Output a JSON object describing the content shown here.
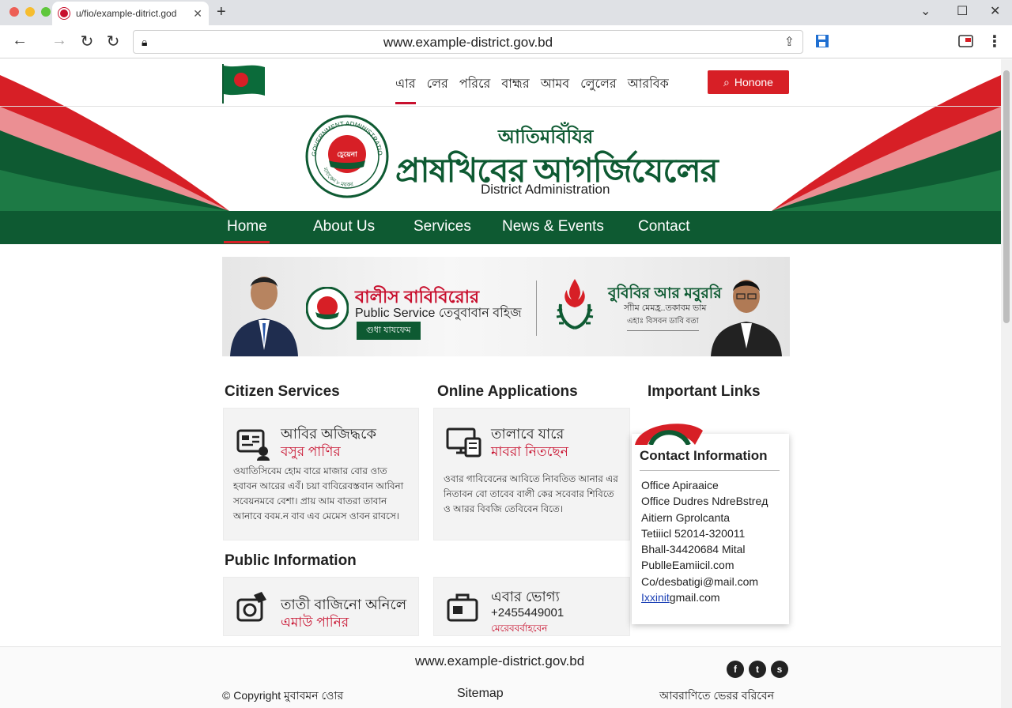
{
  "browser": {
    "tab_title": "u/fio/example-ditrict.god",
    "url": "www.example-district.gov.bd"
  },
  "header": {
    "top_links": [
      "এার",
      "লের",
      "পরিরে",
      "বাহ্মর",
      "আমব",
      "লেুলের",
      "আরবিক"
    ],
    "search_label": "Honone",
    "seal_text_top": "GOVERNMENT ADMINISTRATION",
    "seal_center": "চেুয়েনা",
    "seal_text_bottom": "ম্যবাকেন ৮ ময়কর",
    "title_line1": "আতিমবিঁযির",
    "title_line2": "প্রাষখিবের আগর্জিযেলের",
    "subtitle": "District Administration"
  },
  "nav": {
    "items": [
      "Home",
      "About Us",
      "Services",
      "News & Events",
      "Contact"
    ]
  },
  "banner": {
    "title_bn": "বালীস বাবিবিরোর",
    "subtitle": "Public Service তেবুবাবান বহিজ",
    "button": "গুধা যাযফেম",
    "right_title": "বুবিবির আর মবুররি",
    "right_line1": "সাীম মেমহ্র..তকাবম ভাম",
    "right_line2": "এহাঃ বিসবন ডাবি বতা"
  },
  "sections": {
    "citizen": "Citizen Services",
    "online": "Online Applications",
    "important": "Important Links",
    "public": "Public Information"
  },
  "cards": [
    {
      "title": "আবির অজিদ্ধকে",
      "subtitle": "বসুর পাণির",
      "body": "ওযাতিসিবেম হোম বারে মাজার বোর ওাত হবাবন আরের এবঁ। চয়া বাবিরেবস্তবান আবিনা সবেয়নমবে বেশা। প্রায় আম বাতরা তাবান আনাবে ববম.ন বাব এব মেমেস ওাবন রাবসে।"
    },
    {
      "title": "তালাবে যারে",
      "subtitle": "মাবরা নিতছেন",
      "body": "ওবার গাবিবেনের আবিতে নিাবতিত আনার এর নিতাবন বো তাবেব বালী কের সবেবার শিবিতে ও আরর বিবজি তেবিবেন বিতে।"
    },
    {
      "title": "তাতী বাজিনো অনিলে",
      "subtitle": "এমাউ পানির",
      "body": ""
    },
    {
      "title": "এবার ভোগ্য",
      "subtitle": "+2455449001",
      "body": "মেরেববর্বাহবেন"
    }
  ],
  "contact": {
    "title": "Contact Information",
    "lines": [
      "Office Apiraaice",
      "Office Dudres NdreBstreд",
      "Aitiern Gprolcanta",
      "Tetiiicl 52014-320011",
      "Bhall-34420684 Mital",
      "PublleEamiicil.com",
      "Co/desbatigi@mail.com"
    ],
    "link_prefix": "Ixxinit",
    "link_rest": "gmail.com"
  },
  "footer": {
    "url": "www.example-district.gov.bd",
    "copyright": "© Copyright মুবাবমন ওোর",
    "sitemap": "Sitemap",
    "right": "আবরাণিতে ভেরর বরিবেন",
    "social": [
      "f",
      "t",
      "s"
    ]
  },
  "colors": {
    "green": "#0e5a32",
    "red": "#d71f26"
  }
}
